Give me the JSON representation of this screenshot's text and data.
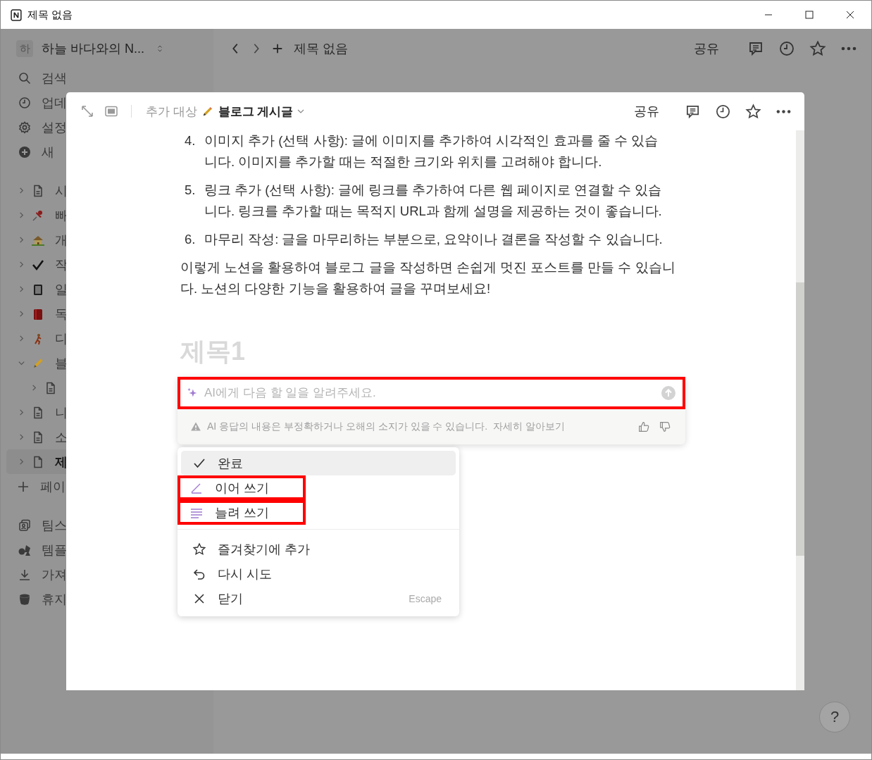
{
  "window": {
    "title": "제목 없음"
  },
  "workspace": {
    "avatar": "하",
    "name": "하늘 바다와의 N..."
  },
  "sidebar": {
    "actions": [
      {
        "label": "검색"
      },
      {
        "label": "업데"
      },
      {
        "label": "설정"
      },
      {
        "label": "새"
      }
    ],
    "pages": [
      {
        "label": "시",
        "expanded": false,
        "selected": false
      },
      {
        "label": "빠",
        "expanded": false,
        "selected": false
      },
      {
        "label": "개",
        "expanded": false,
        "selected": false
      },
      {
        "label": "작",
        "expanded": false,
        "selected": false
      },
      {
        "label": "일",
        "expanded": false,
        "selected": false
      },
      {
        "label": "독",
        "expanded": false,
        "selected": false
      },
      {
        "label": "디",
        "expanded": false,
        "selected": false
      },
      {
        "label": "블",
        "expanded": true,
        "selected": false,
        "children": [
          {
            "expanded": false
          }
        ]
      },
      {
        "label": "니",
        "expanded": false,
        "selected": false
      },
      {
        "label": "소",
        "expanded": false,
        "selected": false
      },
      {
        "label": "제",
        "expanded": false,
        "selected": true
      }
    ],
    "add_page": "페이",
    "footer": [
      {
        "label": "팀스"
      },
      {
        "label": "템플"
      },
      {
        "label": "가져"
      },
      {
        "label": "휴지"
      }
    ]
  },
  "topbar": {
    "breadcrumb": "제목 없음",
    "share": "공유"
  },
  "modal": {
    "target_label": "추가 대상",
    "target": "블로그 게시글",
    "share": "공유",
    "list": [
      {
        "number": "4.",
        "text": "이미지 추가 (선택 사항): 글에 이미지를 추가하여 시각적인 효과를 줄 수 있습니다. 이미지를 추가할 때는 적절한 크기와 위치를 고려해야 합니다."
      },
      {
        "number": "5.",
        "text": "링크 추가 (선택 사항): 글에 링크를 추가하여 다른 웹 페이지로 연결할 수 있습니다. 링크를 추가할 때는 목적지 URL과 함께 설명을 제공하는 것이 좋습니다."
      },
      {
        "number": "6.",
        "text": "마무리 작성: 글을 마무리하는 부분으로, 요약이나 결론을 작성할 수 있습니다."
      }
    ],
    "paragraph": "이렇게 노션을 활용하여 블로그 글을 작성하면 손쉽게 멋진 포스트를 만들 수 있습니다. 노션의 다양한 기능을 활용하여 글을 꾸며보세요!",
    "heading_placeholder": "제목1",
    "ai": {
      "placeholder": "AI에게 다음 할 일을 알려주세요.",
      "highlighted": true,
      "warning": "AI 응답의 내용은 부정확하거나 오해의 소지가 있을 수 있습니다.",
      "link": "자세히 알아보기"
    },
    "menu": [
      [
        {
          "label": "완료",
          "selected": true,
          "highlighted": false
        },
        {
          "label": "이어 쓰기",
          "selected": false,
          "highlighted": true
        },
        {
          "label": "늘려 쓰기",
          "selected": false,
          "highlighted": true
        }
      ],
      [
        {
          "label": "즐겨찾기에 추가",
          "selected": false,
          "highlighted": false
        },
        {
          "label": "다시 시도",
          "selected": false,
          "highlighted": false
        },
        {
          "label": "닫기",
          "shortcut": "Escape",
          "selected": false,
          "highlighted": false
        }
      ]
    ]
  },
  "help": "?"
}
